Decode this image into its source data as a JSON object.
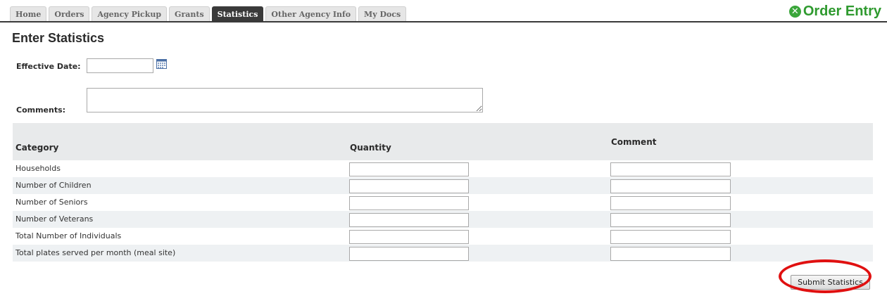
{
  "tabs": [
    {
      "label": "Home",
      "active": false
    },
    {
      "label": "Orders",
      "active": false
    },
    {
      "label": "Agency Pickup",
      "active": false
    },
    {
      "label": "Grants",
      "active": false
    },
    {
      "label": "Statistics",
      "active": true
    },
    {
      "label": "Other Agency Info",
      "active": false
    },
    {
      "label": "My Docs",
      "active": false
    }
  ],
  "brand": {
    "icon": "close-circle-icon",
    "icon_glyph": "✕",
    "label": "Order Entry",
    "color": "#2f9a2f"
  },
  "page_title": "Enter Statistics",
  "form": {
    "effective_date_label": "Effective Date:",
    "effective_date_value": "",
    "calendar_icon": "calendar-icon",
    "comments_label": "Comments:",
    "comments_value": ""
  },
  "grid": {
    "headers": {
      "category": "Category",
      "quantity": "Quantity",
      "comment": "Comment"
    },
    "rows": [
      {
        "category": "Households",
        "quantity": "",
        "comment": ""
      },
      {
        "category": "Number of Children",
        "quantity": "",
        "comment": ""
      },
      {
        "category": "Number of Seniors",
        "quantity": "",
        "comment": ""
      },
      {
        "category": "Number of Veterans",
        "quantity": "",
        "comment": ""
      },
      {
        "category": "Total Number of Individuals",
        "quantity": "",
        "comment": ""
      },
      {
        "category": "Total plates served per month (meal site)",
        "quantity": "",
        "comment": ""
      }
    ]
  },
  "submit_label": "Submit Statistics",
  "colors": {
    "accent": "#3a3a3a",
    "highlight": "#e01010",
    "header_bg": "#e8eaeb",
    "alt_row": "#eef1f3"
  }
}
